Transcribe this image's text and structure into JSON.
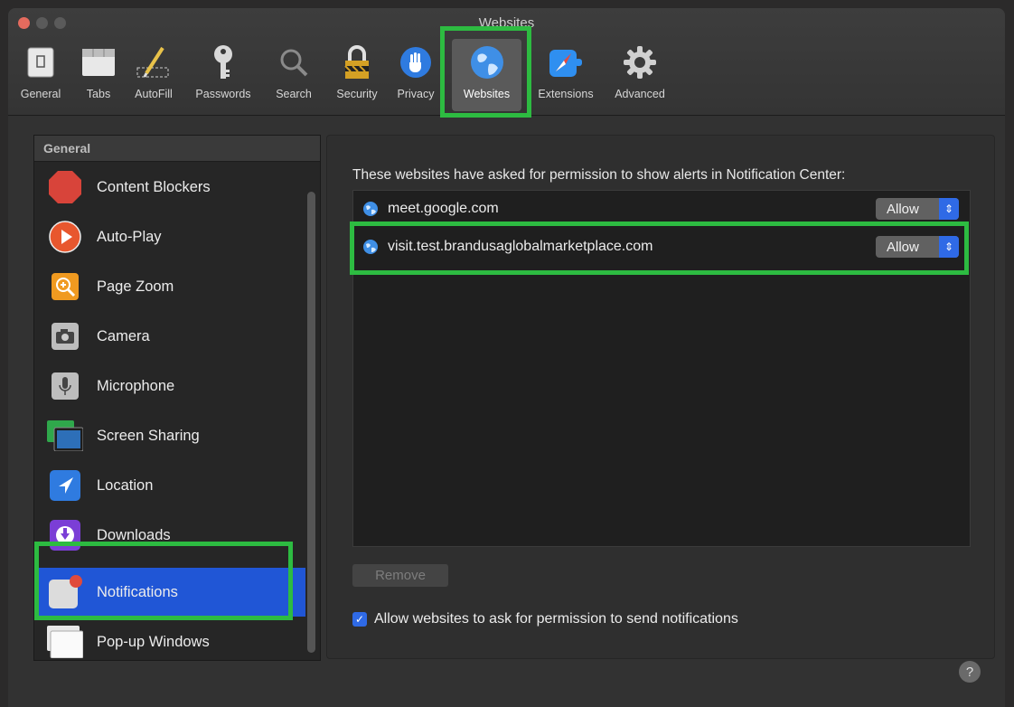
{
  "window": {
    "title": "Websites"
  },
  "toolbar": {
    "items": [
      {
        "label": "General",
        "icon": "general-icon"
      },
      {
        "label": "Tabs",
        "icon": "tabs-icon"
      },
      {
        "label": "AutoFill",
        "icon": "autofill-icon"
      },
      {
        "label": "Passwords",
        "icon": "key-icon"
      },
      {
        "label": "Search",
        "icon": "search-icon"
      },
      {
        "label": "Security",
        "icon": "lock-icon"
      },
      {
        "label": "Privacy",
        "icon": "hand-icon"
      },
      {
        "label": "Websites",
        "icon": "globe-icon"
      },
      {
        "label": "Extensions",
        "icon": "compass-icon"
      },
      {
        "label": "Advanced",
        "icon": "gear-icon"
      }
    ],
    "selected": "Websites"
  },
  "sidebar": {
    "header": "General",
    "items": [
      {
        "label": "Content Blockers",
        "icon": "stop-icon"
      },
      {
        "label": "Auto-Play",
        "icon": "play-icon"
      },
      {
        "label": "Page Zoom",
        "icon": "zoom-icon"
      },
      {
        "label": "Camera",
        "icon": "camera-icon"
      },
      {
        "label": "Microphone",
        "icon": "microphone-icon"
      },
      {
        "label": "Screen Sharing",
        "icon": "screen-icon"
      },
      {
        "label": "Location",
        "icon": "location-icon"
      },
      {
        "label": "Downloads",
        "icon": "download-icon"
      },
      {
        "label": "Notifications",
        "icon": "notification-icon"
      },
      {
        "label": "Pop-up Windows",
        "icon": "popup-icon"
      }
    ],
    "selected": "Notifications"
  },
  "main": {
    "description": "These websites have asked for permission to show alerts in Notification Center:",
    "sites": [
      {
        "domain": "meet.google.com",
        "permission": "Allow"
      },
      {
        "domain": "visit.test.brandusaglobalmarketplace.com",
        "permission": "Allow"
      }
    ],
    "remove_label": "Remove",
    "allow_checkbox_label": "Allow websites to ask for permission to send notifications",
    "allow_checkbox_checked": true
  },
  "help_label": "?",
  "colors": {
    "highlight": "#2dbb41",
    "selection": "#2056d6",
    "accent": "#2f6ae6"
  }
}
